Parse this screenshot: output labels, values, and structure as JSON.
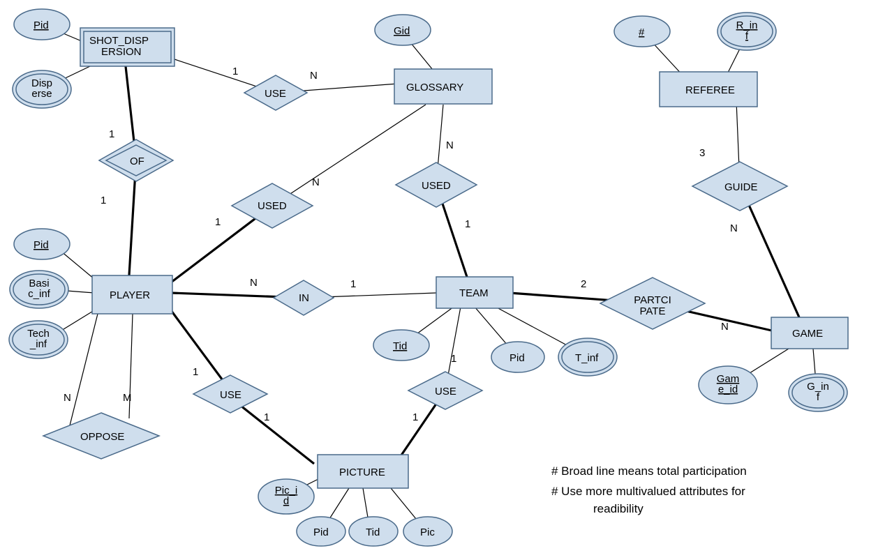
{
  "entities": {
    "shot_dispersion": "SHOT_DISPERSION",
    "glossary": "GLOSSARY",
    "referee": "REFEREE",
    "player": "PLAYER",
    "team": "TEAM",
    "game": "GAME",
    "picture": "PICTURE"
  },
  "relationships": {
    "use1": "USE",
    "of": "OF",
    "used1": "USED",
    "used2": "USED",
    "in": "IN",
    "guide": "GUIDE",
    "participate": "PARTCIPATE",
    "oppose": "OPPOSE",
    "use2": "USE",
    "use3": "USE"
  },
  "attributes": {
    "sd_pid": "Pid",
    "sd_disperse1": "Disp",
    "sd_disperse2": "erse",
    "glossary_gid": "Gid",
    "ref_hash": "#",
    "ref_rinf1": "R_in",
    "ref_rinf2": "f",
    "player_pid": "Pid",
    "player_basic1": "Basi",
    "player_basic2": "c_inf",
    "player_tech1": "Tech",
    "player_tech2": "_inf",
    "team_tid": "Tid",
    "team_pid": "Pid",
    "team_tinf": "T_inf",
    "game_id1": "Gam",
    "game_id2": "e_id",
    "game_ginf1": "G_in",
    "game_ginf2": "f",
    "pic_id1": "Pic_i",
    "pic_id2": "d",
    "pic_pid": "Pid",
    "pic_tid": "Tid",
    "pic_pic": "Pic"
  },
  "cardinalities": {
    "sd_use": "1",
    "glossary_use": "N",
    "sd_of": "1",
    "player_of": "1",
    "player_used1": "1",
    "glossary_used1": "N",
    "glossary_used2": "N",
    "team_used2": "1",
    "player_in": "N",
    "team_in": "1",
    "ref_guide": "3",
    "game_guide": "N",
    "team_part": "2",
    "game_part": "N",
    "oppose_n": "N",
    "oppose_m": "M",
    "player_use2": "1",
    "pic_use2": "1",
    "team_use3": "1",
    "pic_use3": "1"
  },
  "notes": {
    "line1": "# Broad line means  total participation",
    "line2": "# Use more multivalued attributes for",
    "line3": "readibility"
  }
}
